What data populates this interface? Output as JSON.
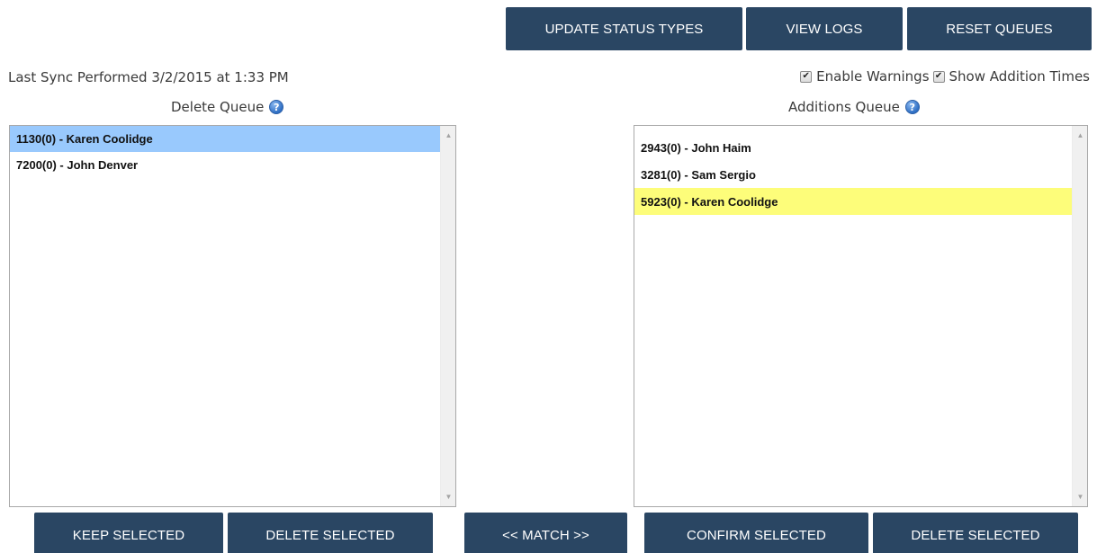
{
  "toolbar": {
    "update_status_types": "UPDATE STATUS TYPES",
    "view_logs": "VIEW LOGS",
    "reset_queues": "RESET QUEUES"
  },
  "sync": {
    "last_sync_text": "Last Sync Performed 3/2/2015 at 1:33 PM"
  },
  "options": {
    "enable_warnings": {
      "label": "Enable Warnings",
      "checked": true
    },
    "show_addition_times": {
      "label": "Show Addition Times",
      "checked": true
    }
  },
  "delete_queue": {
    "title": "Delete Queue",
    "items": [
      {
        "text": "1130(0) - Karen Coolidge",
        "selected": true
      },
      {
        "text": "7200(0) - John Denver",
        "selected": false
      }
    ]
  },
  "additions_queue": {
    "title": "Additions Queue",
    "items": [
      {
        "text": "2943(0) - John Haim",
        "highlighted": false
      },
      {
        "text": "3281(0) - Sam Sergio",
        "highlighted": false
      },
      {
        "text": "5923(0) - Karen Coolidge",
        "highlighted": true
      }
    ]
  },
  "actions": {
    "keep_selected": "KEEP SELECTED",
    "delete_selected_left": "DELETE SELECTED",
    "match": "<< MATCH >>",
    "confirm_selected": "CONFIRM SELECTED",
    "delete_selected_right": "DELETE SELECTED"
  },
  "colors": {
    "button_bg": "#2a4663",
    "selected_blue": "#99c9fd",
    "highlight_yellow": "#fdfd7a"
  },
  "icons": {
    "help": "help-icon",
    "checkbox": "checkmark-icon",
    "scroll_up": "arrow-up-icon",
    "scroll_down": "arrow-down-icon"
  }
}
